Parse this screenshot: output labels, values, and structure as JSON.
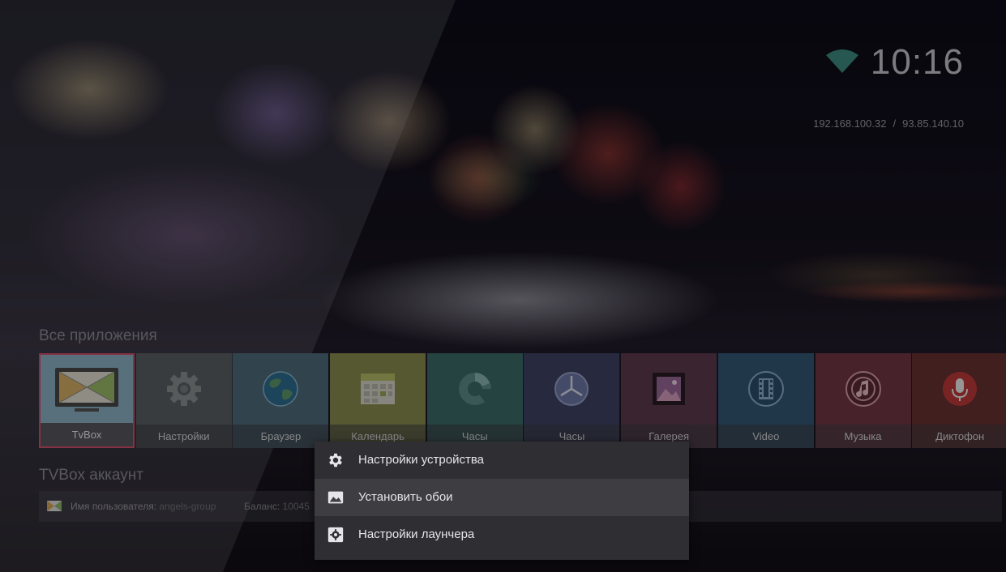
{
  "status": {
    "time": "10:16",
    "ip_local": "192.168.100.32",
    "ip_separator": "/",
    "ip_external": "93.85.140.10",
    "wifi_icon": "wifi-icon"
  },
  "apps_section": {
    "title": "Все приложения",
    "apps": [
      {
        "label": "TvBox",
        "icon": "tvbox-icon",
        "color": "#8fb3c8",
        "focused": true
      },
      {
        "label": "Настройки",
        "icon": "gear-icon",
        "color": "#5d6265"
      },
      {
        "label": "Браузер",
        "icon": "globe-icon",
        "color": "#4f6e7e"
      },
      {
        "label": "Календарь",
        "icon": "calendar-icon",
        "color": "#8a8e4e"
      },
      {
        "label": "Часы",
        "icon": "clock-icon",
        "color": "#3d6c6a"
      },
      {
        "label": "Часы",
        "icon": "time-icon",
        "color": "#3f4566"
      },
      {
        "label": "Галерея",
        "icon": "gallery-icon",
        "color": "#5d3b4e"
      },
      {
        "label": "Video",
        "icon": "video-icon",
        "color": "#355a78"
      },
      {
        "label": "Музыка",
        "icon": "music-icon",
        "color": "#753846"
      },
      {
        "label": "Диктофон",
        "icon": "microphone-icon",
        "color": "#6a3232"
      }
    ]
  },
  "account_section": {
    "title": "TVBox аккаунт",
    "username_label": "Имя пользователя:",
    "username_value": "angels-group",
    "balance_label": "Баланс:",
    "balance_value": "10045"
  },
  "context_menu": {
    "items": [
      {
        "label": "Настройки устройства",
        "icon": "gear-icon"
      },
      {
        "label": "Установить обои",
        "icon": "image-icon"
      },
      {
        "label": "Настройки лаунчера",
        "icon": "settings-box-icon"
      }
    ]
  }
}
